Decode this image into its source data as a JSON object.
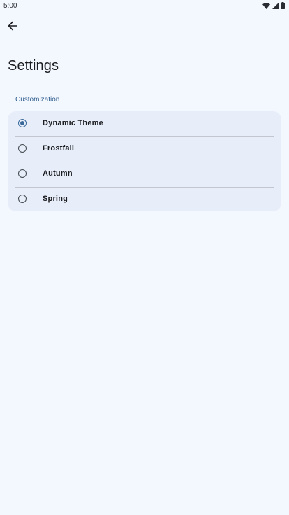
{
  "status_bar": {
    "time": "5:00",
    "icons": [
      "wifi-icon",
      "cell-signal-icon",
      "battery-icon"
    ]
  },
  "toolbar": {
    "back_icon": "arrow-back-icon"
  },
  "page": {
    "title": "Settings"
  },
  "section": {
    "header": "Customization"
  },
  "options": [
    {
      "label": "Dynamic Theme",
      "selected": true
    },
    {
      "label": "Frostfall",
      "selected": false
    },
    {
      "label": "Autumn",
      "selected": false
    },
    {
      "label": "Spring",
      "selected": false
    }
  ],
  "colors": {
    "background": "#f3f7fe",
    "card": "#e7eef9",
    "accent": "#3a6a9c",
    "section_header": "#315f8f",
    "divider": "#c3c6cf"
  }
}
